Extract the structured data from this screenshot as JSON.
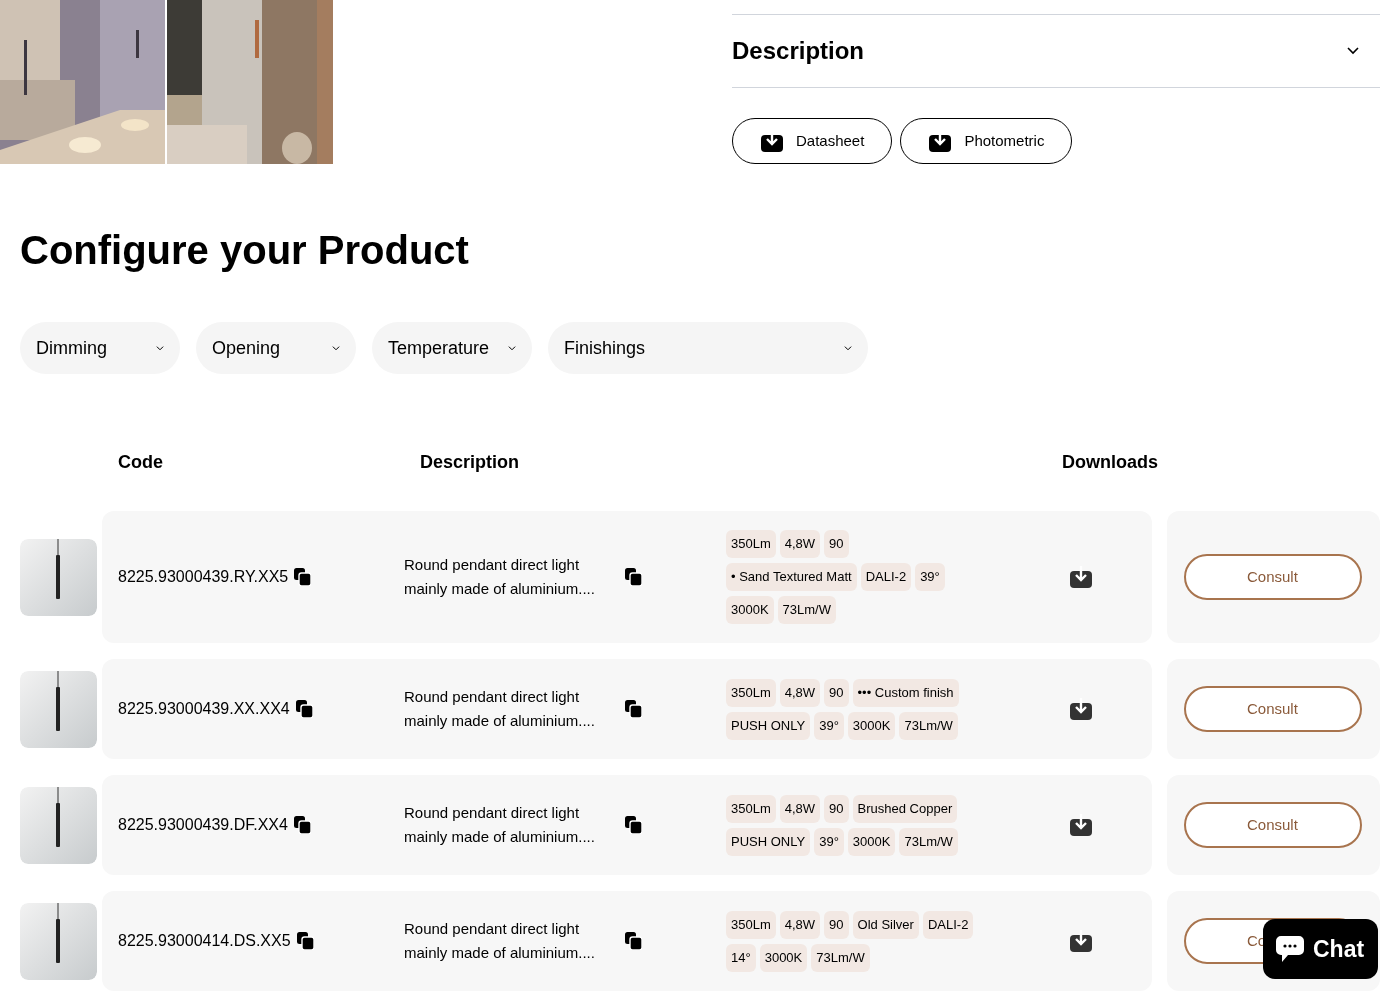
{
  "gallery": [
    {
      "kind": "picture"
    },
    {
      "kind": "picture"
    }
  ],
  "description_section": {
    "title": "Description",
    "expanded": false
  },
  "download_buttons": [
    "Datasheet",
    "Photometric"
  ],
  "configurator": {
    "title": "Configure your Product",
    "filters": [
      "Dimming",
      "Opening",
      "Temperature",
      "Finishings"
    ]
  },
  "table": {
    "columns": [
      "Code",
      "Description",
      "Downloads"
    ],
    "rows": [
      {
        "code": "8225.93000439.RY.XX5",
        "description": "Round pendant direct light mainly made of aluminium....",
        "tag_lines": [
          [
            "350Lm",
            "4,8W",
            "90"
          ],
          [
            "• Sand Textured Matt",
            "DALI-2",
            "39°"
          ],
          [
            "3000K",
            "73Lm/W"
          ]
        ],
        "action": "Consult"
      },
      {
        "code": "8225.93000439.XX.XX4",
        "description": "Round pendant direct light mainly made of aluminium....",
        "tag_lines": [
          [
            "350Lm",
            "4,8W",
            "90",
            "••• Custom finish"
          ],
          [
            "PUSH ONLY",
            "39°",
            "3000K",
            "73Lm/W"
          ]
        ],
        "action": "Consult"
      },
      {
        "code": "8225.93000439.DF.XX4",
        "description": "Round pendant direct light mainly made of aluminium....",
        "tag_lines": [
          [
            "350Lm",
            "4,8W",
            "90",
            "Brushed Copper"
          ],
          [
            "PUSH ONLY",
            "39°",
            "3000K",
            "73Lm/W"
          ]
        ],
        "action": "Consult"
      },
      {
        "code": "8225.93000414.DS.XX5",
        "description": "Round pendant direct light mainly made of aluminium....",
        "tag_lines": [
          [
            "350Lm",
            "4,8W",
            "90",
            "Old Silver",
            "DALI-2"
          ],
          [
            "14°",
            "3000K",
            "73Lm/W"
          ]
        ],
        "action": "Co"
      }
    ]
  },
  "chat_button": "Chat"
}
